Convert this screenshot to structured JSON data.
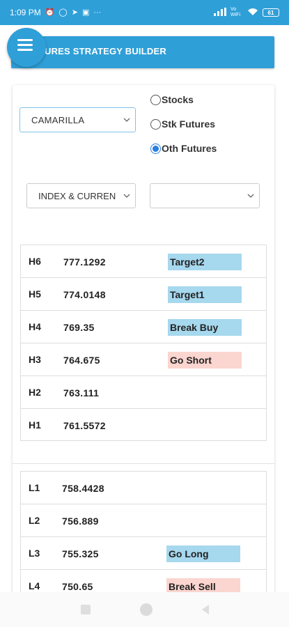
{
  "status_bar": {
    "time": "1:09 PM",
    "icons_left": [
      "alarm-icon",
      "whatsapp-icon",
      "telegram-icon",
      "message-icon"
    ],
    "more": "···",
    "network_label": "Vo WiFi",
    "battery": "61"
  },
  "header": {
    "title": "URES STRATEGY BUILDER"
  },
  "form": {
    "strategy_select": "CAMARILLA",
    "radios": [
      {
        "label": "Stocks",
        "selected": false
      },
      {
        "label": "Stk Futures",
        "selected": false
      },
      {
        "label": "Oth Futures",
        "selected": true
      }
    ],
    "segment_select": "INDEX & CURRENCY",
    "symbol_select": ""
  },
  "high_levels": [
    {
      "level": "H6",
      "value": "777.1292",
      "signal": "Target2",
      "signal_style": "blue"
    },
    {
      "level": "H5",
      "value": "774.0148",
      "signal": "Target1",
      "signal_style": "blue"
    },
    {
      "level": "H4",
      "value": "769.35",
      "signal": "Break Buy",
      "signal_style": "blue"
    },
    {
      "level": "H3",
      "value": "764.675",
      "signal": "Go Short",
      "signal_style": "pink"
    },
    {
      "level": "H2",
      "value": "763.111",
      "signal": "",
      "signal_style": ""
    },
    {
      "level": "H1",
      "value": "761.5572",
      "signal": "",
      "signal_style": ""
    }
  ],
  "low_levels": [
    {
      "level": "L1",
      "value": "758.4428",
      "signal": "",
      "signal_style": ""
    },
    {
      "level": "L2",
      "value": "756.889",
      "signal": "",
      "signal_style": ""
    },
    {
      "level": "L3",
      "value": "755.325",
      "signal": "Go Long",
      "signal_style": "blue"
    },
    {
      "level": "L4",
      "value": "750.65",
      "signal": "Break Sell",
      "signal_style": "pink"
    }
  ],
  "colors": {
    "primary": "#2f9fd8",
    "signal_blue": "#a6d8ee",
    "signal_pink": "#fbd5cf",
    "radio_active": "#2a7fe0"
  }
}
